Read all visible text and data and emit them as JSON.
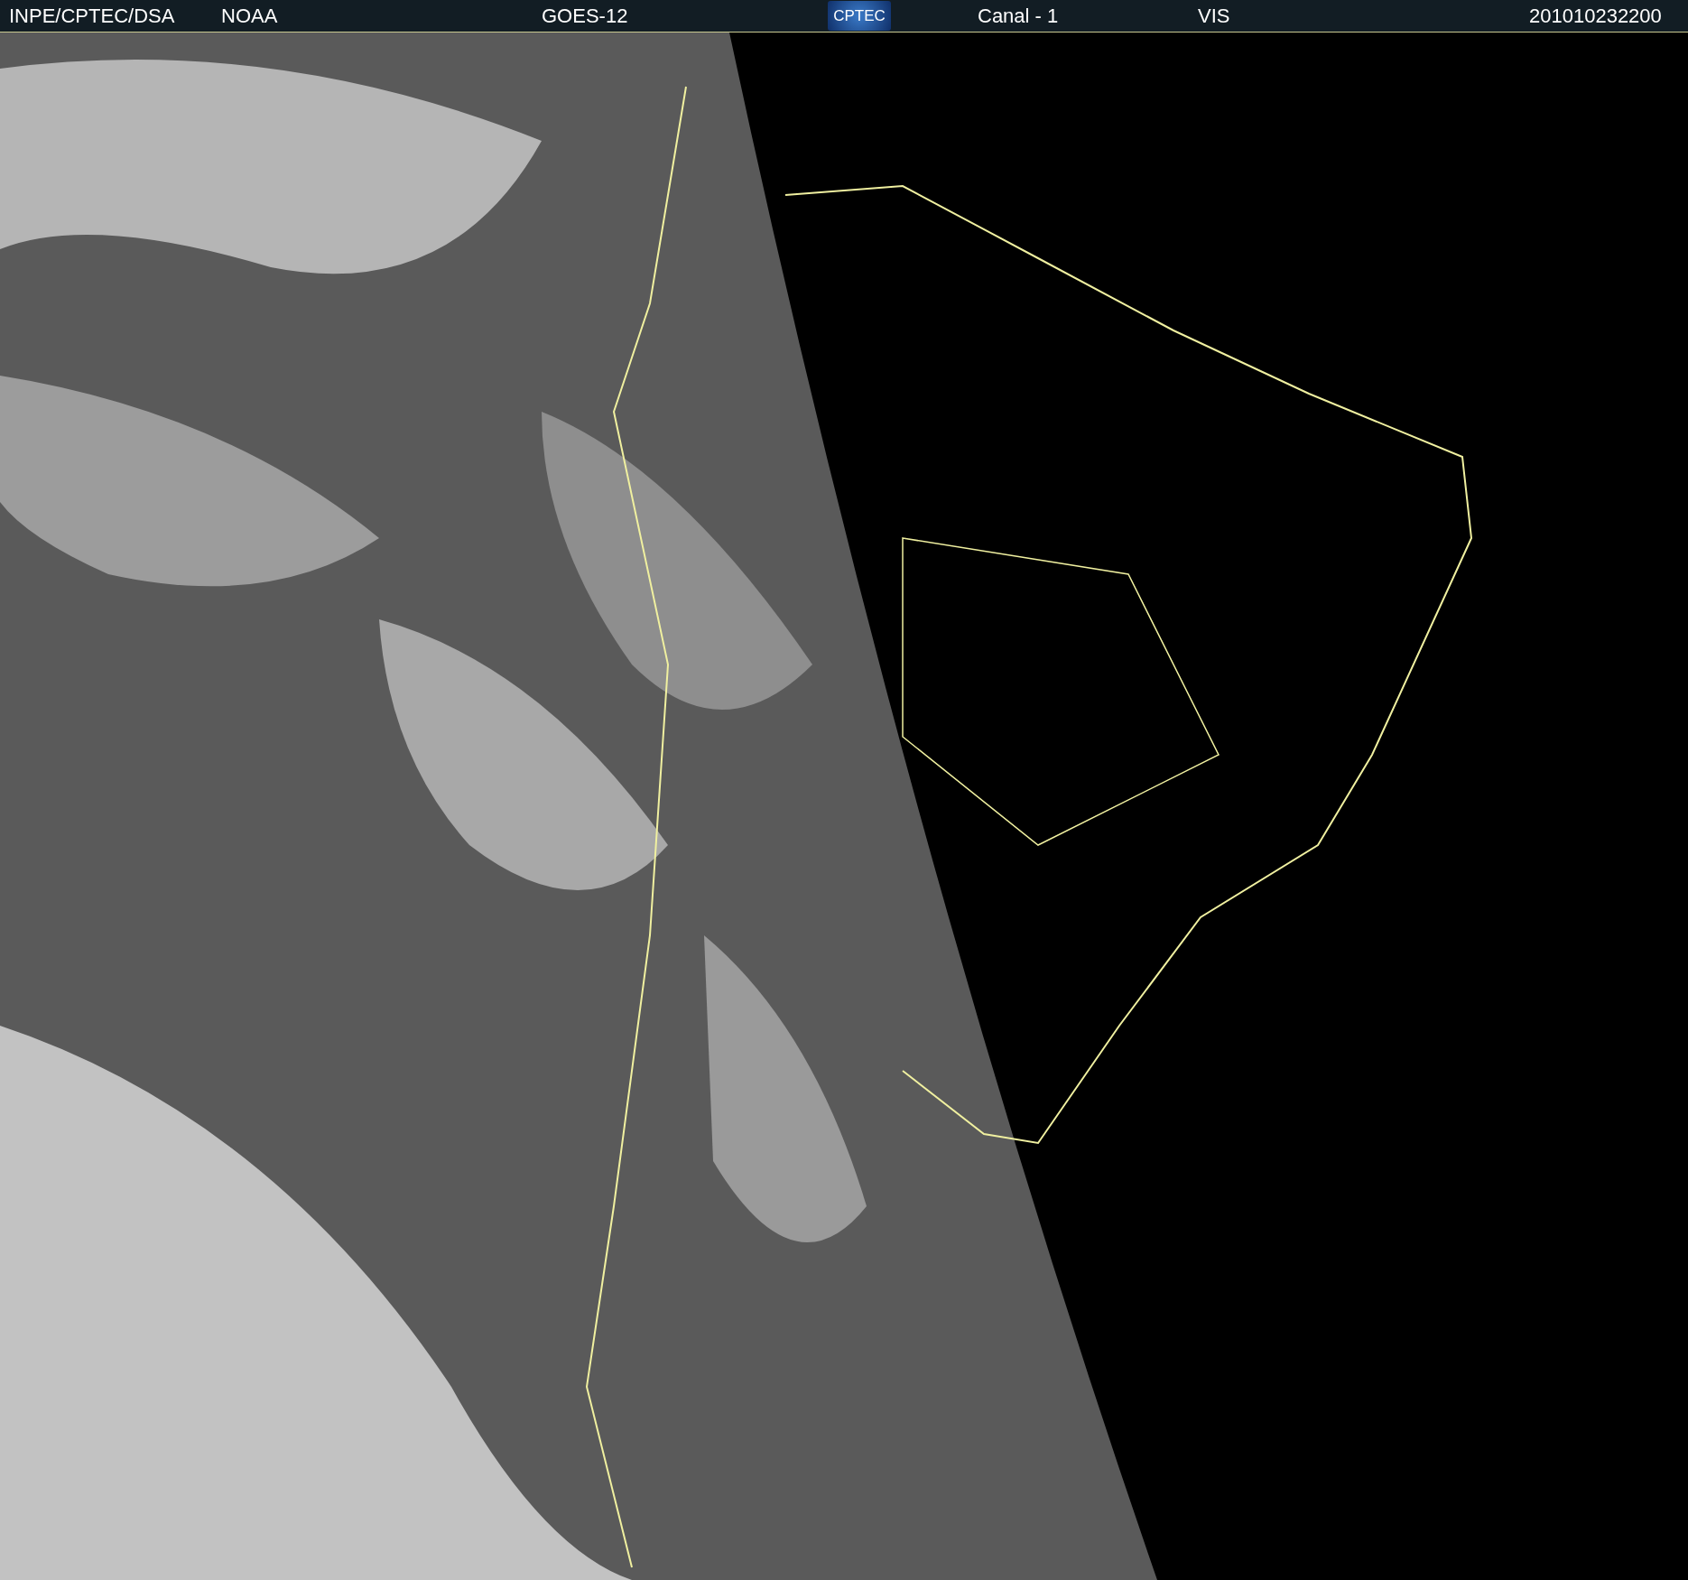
{
  "header": {
    "source": "INPE/CPTEC/DSA",
    "agency": "NOAA",
    "satellite": "GOES-12",
    "logo": "CPTEC",
    "channel": "Canal - 1",
    "band": "VIS",
    "timestamp": "201010232200"
  }
}
